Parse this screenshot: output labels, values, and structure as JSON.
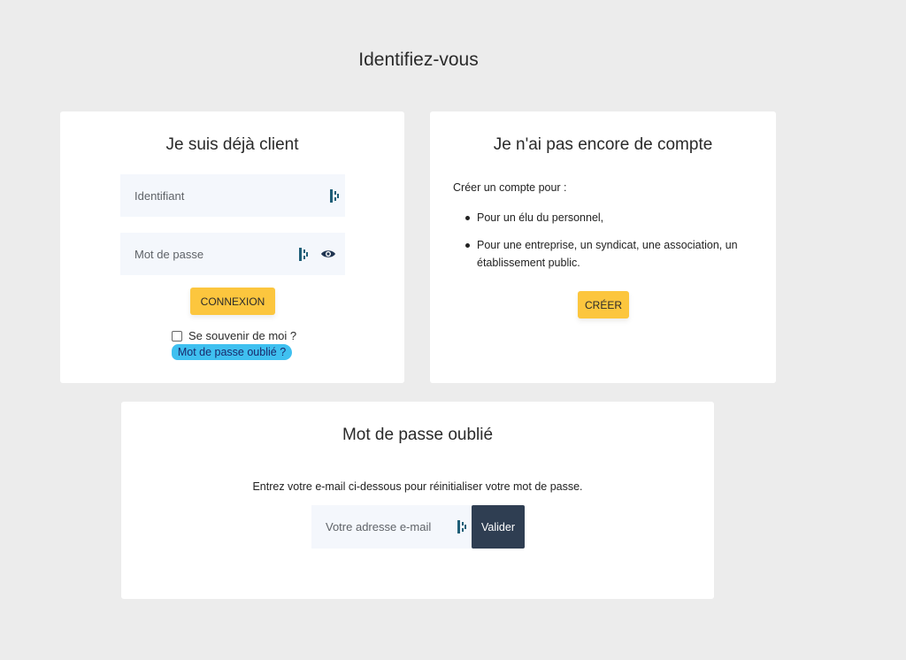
{
  "page": {
    "title": "Identifiez-vous"
  },
  "login": {
    "title": "Je suis déjà client",
    "username_placeholder": "Identifiant",
    "password_placeholder": "Mot de passe",
    "submit_label": "CONNEXION",
    "remember_label": "Se souvenir de moi ?",
    "remember_checked": false,
    "forgot_link": "Mot de passe oublié ?"
  },
  "create": {
    "title": "Je n'ai pas encore de compte",
    "intro": "Créer un compte pour :",
    "items": [
      "Pour un élu du personnel,",
      "Pour une entreprise, un syndicat, une association, un établissement public."
    ],
    "button_label": "CRÉER"
  },
  "forgot": {
    "title": "Mot de passe oublié",
    "description": "Entrez votre e-mail ci-dessous pour réinitialiser votre mot de passe.",
    "email_placeholder": "Votre adresse e-mail",
    "submit_label": "Valider"
  },
  "colors": {
    "background": "#ececec",
    "accent_yellow": "#fcc63e",
    "dark_button": "#2f3e52",
    "link_highlight": "#3fc0f0",
    "field_background": "#f4f7fc"
  },
  "icons": [
    "bitwarden-icon",
    "eye-icon"
  ]
}
